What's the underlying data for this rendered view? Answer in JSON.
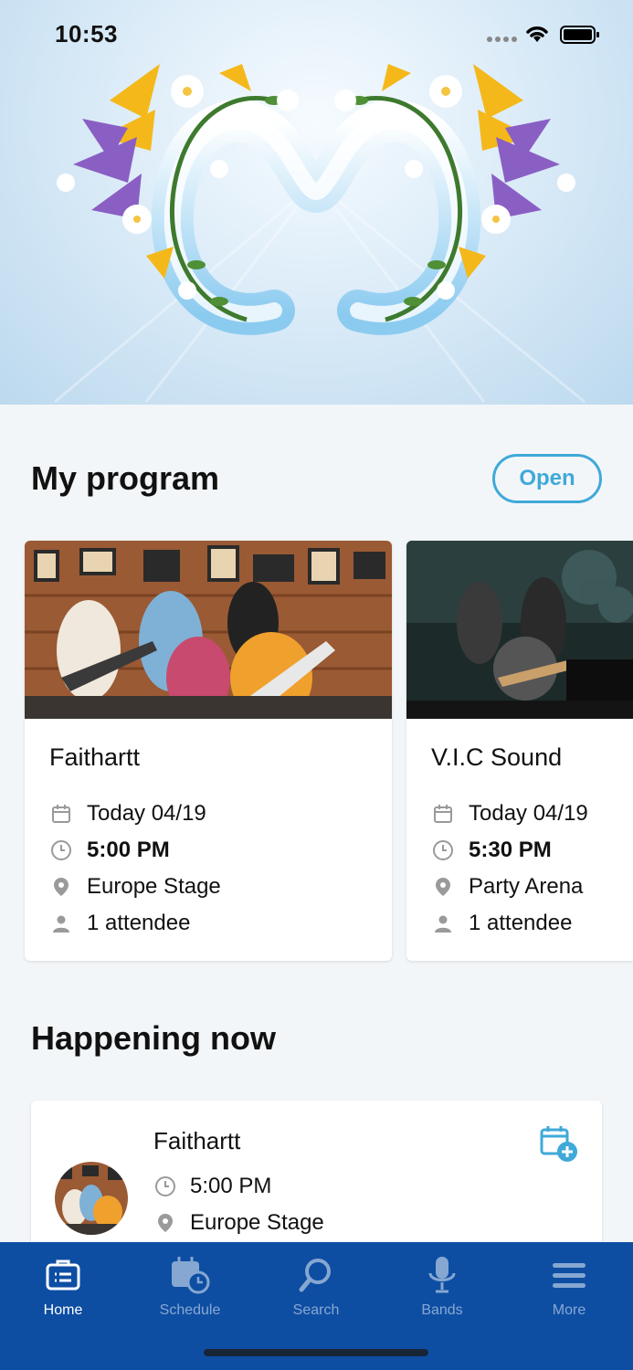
{
  "status_bar": {
    "time": "10:53"
  },
  "my_program": {
    "title": "My program",
    "open_label": "Open",
    "cards": [
      {
        "name": "Faithartt",
        "date": "Today 04/19",
        "time": "5:00 PM",
        "location": "Europe Stage",
        "attendees": "1 attendee"
      },
      {
        "name": "V.I.C Sound",
        "date": "Today 04/19",
        "time": "5:30 PM",
        "location": "Party Arena",
        "attendees": "1 attendee"
      }
    ]
  },
  "happening_now": {
    "title": "Happening now",
    "items": [
      {
        "name": "Faithartt",
        "time": "5:00 PM",
        "location": "Europe Stage"
      }
    ]
  },
  "tabbar": {
    "items": [
      {
        "label": "Home",
        "icon": "home-icon",
        "active": true
      },
      {
        "label": "Schedule",
        "icon": "schedule-icon",
        "active": false
      },
      {
        "label": "Search",
        "icon": "search-icon",
        "active": false
      },
      {
        "label": "Bands",
        "icon": "microphone-icon",
        "active": false
      },
      {
        "label": "More",
        "icon": "menu-icon",
        "active": false
      }
    ]
  },
  "colors": {
    "accent": "#3fa9d9",
    "tabbar": "#0d4ea3",
    "background": "#f3f6f8"
  }
}
